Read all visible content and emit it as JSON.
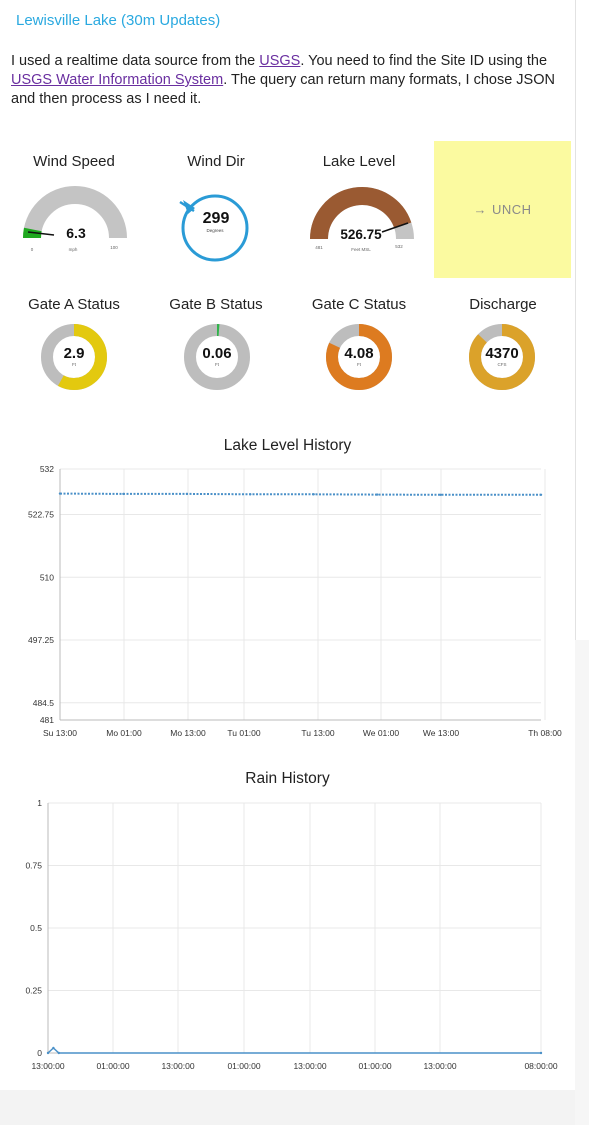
{
  "title": "Lewisville Lake (30m Updates)",
  "intro": {
    "t1": "I used a realtime data source from the ",
    "link1": "USGS",
    "t2": ". You need to find the Site ID using the ",
    "link2": "USGS Water Information System",
    "t3": ". The query can return many formats, I chose JSON and then process as I need it."
  },
  "gauges": {
    "wind_speed": {
      "label": "Wind Speed",
      "value": "6.3",
      "unit": "mph",
      "min": "0",
      "max": "100",
      "color": "#1fa81f"
    },
    "wind_dir": {
      "label": "Wind Dir",
      "value": "299",
      "unit": "Degrees",
      "color": "#2a9bd6"
    },
    "lake_level": {
      "label": "Lake Level",
      "value": "526.75",
      "unit": "Feet MSL",
      "min": "481",
      "max": "532",
      "color": "#9a5a32"
    },
    "trend": {
      "icon": "arrow-right-icon",
      "text": "UNCH"
    }
  },
  "donuts": {
    "gate_a": {
      "label": "Gate A Status",
      "value": "2.9",
      "unit": "Ft",
      "fraction": 0.58,
      "color": "#e3c90f"
    },
    "gate_b": {
      "label": "Gate B Status",
      "value": "0.06",
      "unit": "Ft",
      "fraction": 0.012,
      "color": "#2fb34a"
    },
    "gate_c": {
      "label": "Gate C Status",
      "value": "4.08",
      "unit": "Ft",
      "fraction": 0.82,
      "color": "#dd7b20"
    },
    "discharge": {
      "label": "Discharge",
      "value": "4370",
      "unit": "CFS",
      "fraction": 0.87,
      "color": "#dba22a"
    }
  },
  "chart_data": [
    {
      "type": "line",
      "title": "Lake Level History",
      "xlabel": "",
      "ylabel": "",
      "ylim": [
        481,
        532
      ],
      "yticks": [
        "532",
        "522.75",
        "510",
        "497.25",
        "484.5",
        "481"
      ],
      "xticks": [
        "Su 13:00",
        "Mo 01:00",
        "Mo 13:00",
        "Tu 01:00",
        "Tu 13:00",
        "We 01:00",
        "We 13:00",
        "Th 08:00"
      ],
      "series": [
        {
          "x": [
            0,
            12,
            24,
            36,
            48,
            60,
            72,
            91
          ],
          "values": [
            527.0,
            526.95,
            526.95,
            526.85,
            526.85,
            526.8,
            526.75,
            526.75
          ],
          "color": "#4a90c8"
        }
      ],
      "grid": true
    },
    {
      "type": "line",
      "title": "Rain History",
      "xlabel": "",
      "ylabel": "",
      "ylim": [
        0,
        1
      ],
      "yticks": [
        "1",
        "0.75",
        "0.5",
        "0.25",
        "0"
      ],
      "xticks": [
        "13:00:00",
        "01:00:00",
        "13:00:00",
        "01:00:00",
        "13:00:00",
        "01:00:00",
        "13:00:00",
        "08:00:00"
      ],
      "series": [
        {
          "x": [
            0,
            1,
            2,
            91
          ],
          "values": [
            0,
            0.02,
            0,
            0
          ],
          "color": "#4a90c8"
        }
      ],
      "grid": true
    }
  ]
}
